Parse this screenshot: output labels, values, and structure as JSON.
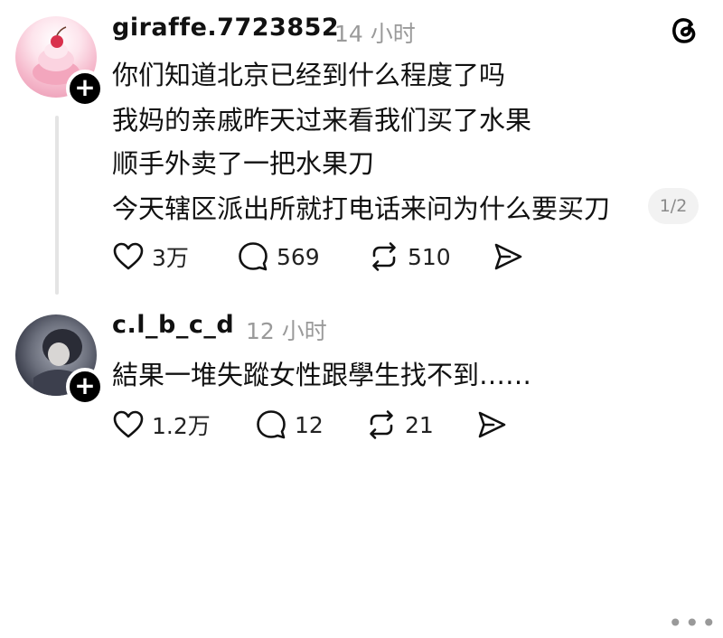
{
  "posts": [
    {
      "username": "giraffe.7723852",
      "time": "14 小时",
      "lines": [
        "你们知道北京已经到什么程度了吗",
        "我妈的亲戚昨天过来看我们买了水果",
        "顺手外卖了一把水果刀",
        "今天辖区派出所就打电话来问为什么要买刀"
      ],
      "page_indicator": "1/2",
      "likes": "3万",
      "comments": "569",
      "reposts": "510"
    },
    {
      "username": "c.l_b_c_d",
      "time": "12 小时",
      "lines": [
        "結果一堆失蹤女性跟學生找不到……"
      ],
      "likes": "1.2万",
      "comments": "12",
      "reposts": "21"
    }
  ],
  "icons": {
    "logo": "threads-icon",
    "follow": "plus-icon",
    "like": "heart-icon",
    "comment": "comment-icon",
    "repost": "repost-icon",
    "share": "send-icon",
    "more": "more-icon"
  },
  "colors": {
    "text": "#111111",
    "muted": "#9a9a9a",
    "thread_line": "#e4e4e4"
  }
}
